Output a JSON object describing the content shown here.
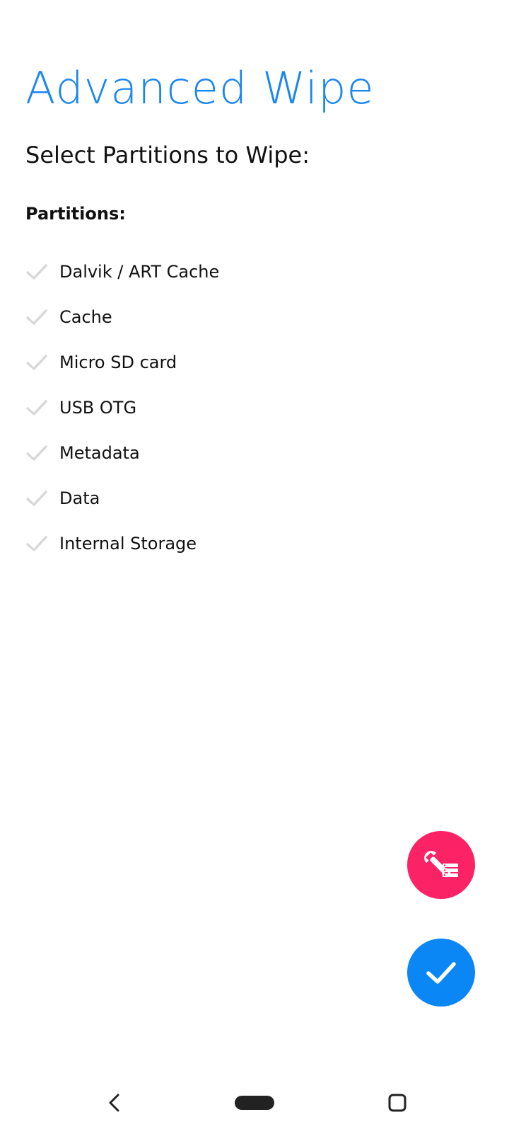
{
  "header": {
    "title": "Advanced Wipe",
    "subtitle": "Select Partitions to Wipe:"
  },
  "partitions": {
    "label": "Partitions:",
    "items": [
      {
        "label": "Dalvik / ART Cache",
        "checked": false
      },
      {
        "label": "Cache",
        "checked": false
      },
      {
        "label": "Micro SD card",
        "checked": false
      },
      {
        "label": "USB OTG",
        "checked": false
      },
      {
        "label": "Metadata",
        "checked": false
      },
      {
        "label": "Data",
        "checked": false
      },
      {
        "label": "Internal Storage",
        "checked": false
      }
    ]
  },
  "fabs": {
    "tools": {
      "icon": "wrench-storage-icon",
      "color": "#fb2366"
    },
    "confirm": {
      "icon": "checkmark-icon",
      "color": "#0b86f5"
    }
  },
  "navigation": {
    "back_icon": "back-chevron-icon",
    "home_icon": "home-pill-icon",
    "recents_icon": "recents-square-icon"
  },
  "colors": {
    "accent": "#1a86f0",
    "unchecked": "#d9d9d9"
  }
}
